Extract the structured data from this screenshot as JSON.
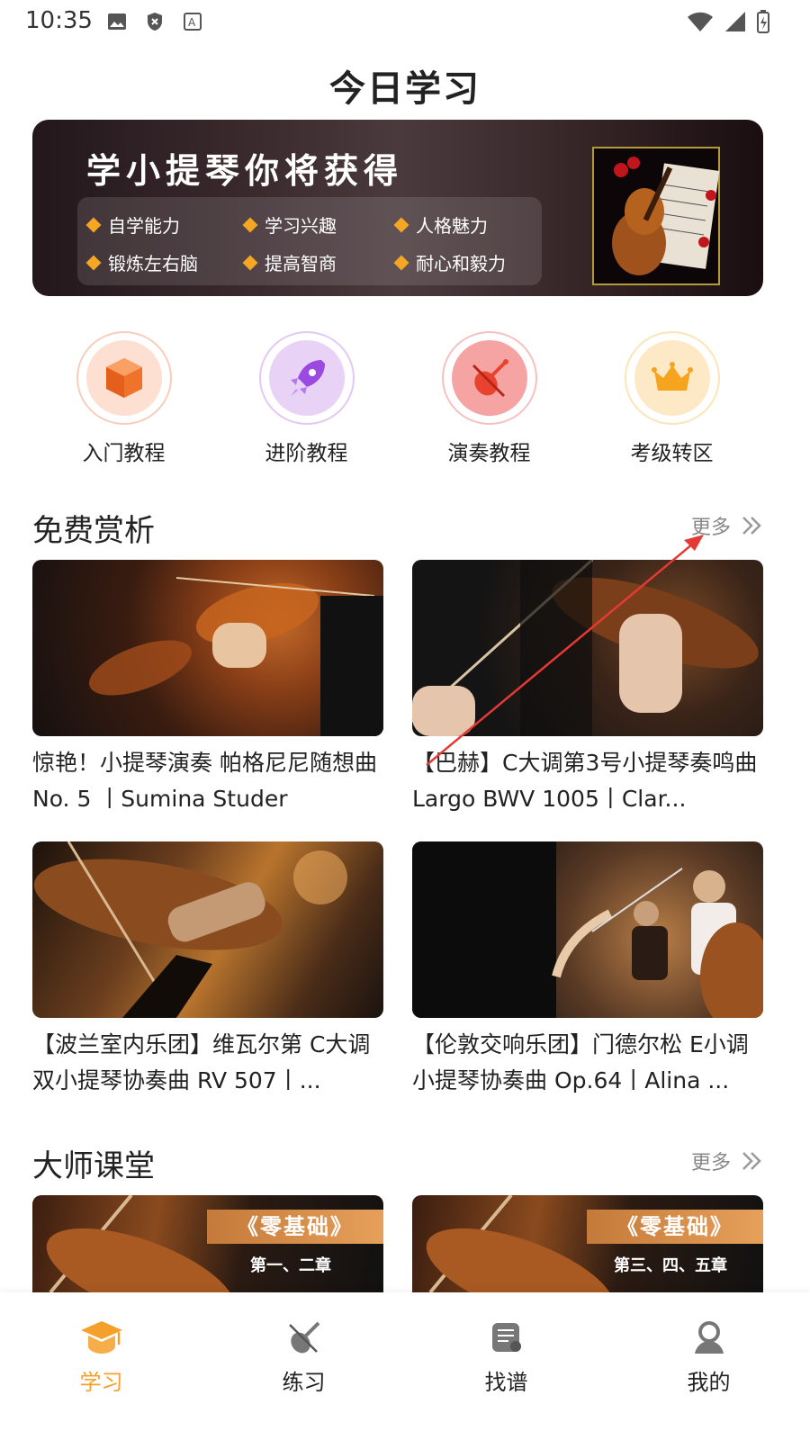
{
  "status_bar": {
    "time": "10:35",
    "left_icons": [
      "image-icon",
      "shield-icon",
      "font-icon"
    ],
    "right_icons": [
      "wifi-icon",
      "signal-icon",
      "battery-icon"
    ]
  },
  "page": {
    "title": "今日学习"
  },
  "banner": {
    "title": "学小提琴你将获得",
    "benefits": [
      "自学能力",
      "学习兴趣",
      "人格魅力",
      "锻炼左右脑",
      "提高智商",
      "耐心和毅力"
    ]
  },
  "categories": [
    {
      "label": "入门教程",
      "icon": "cube-icon"
    },
    {
      "label": "进阶教程",
      "icon": "rocket-icon"
    },
    {
      "label": "演奏教程",
      "icon": "violin-icon"
    },
    {
      "label": "考级转区",
      "icon": "crown-icon"
    }
  ],
  "free_section": {
    "title": "免费赏析",
    "more": "更多",
    "cards": [
      {
        "title": "惊艳！小提琴演奏 帕格尼尼随想曲No. 5 丨Sumina Studer"
      },
      {
        "title": "【巴赫】C大调第3号小提琴奏鸣曲 Largo BWV 1005丨Clar..."
      },
      {
        "title": "【波兰室内乐团】维瓦尔第 C大调双小提琴协奏曲 RV 507丨..."
      },
      {
        "title": "【伦敦交响乐团】门德尔松 E小调小提琴协奏曲 Op.64丨Alina ..."
      }
    ]
  },
  "master_section": {
    "title": "大师课堂",
    "more": "更多",
    "cards": [
      {
        "tag": "《零基础》",
        "subtitle": "第一、二章"
      },
      {
        "tag": "《零基础》",
        "subtitle": "第三、四、五章"
      }
    ]
  },
  "bottom_nav": [
    {
      "label": "学习",
      "icon": "graduation-cap-icon",
      "active": true
    },
    {
      "label": "练习",
      "icon": "violin-icon",
      "active": false
    },
    {
      "label": "找谱",
      "icon": "score-icon",
      "active": false
    },
    {
      "label": "我的",
      "icon": "user-icon",
      "active": false
    }
  ],
  "colors": {
    "accent": "#f5a02a",
    "annotation": "#e53935"
  }
}
